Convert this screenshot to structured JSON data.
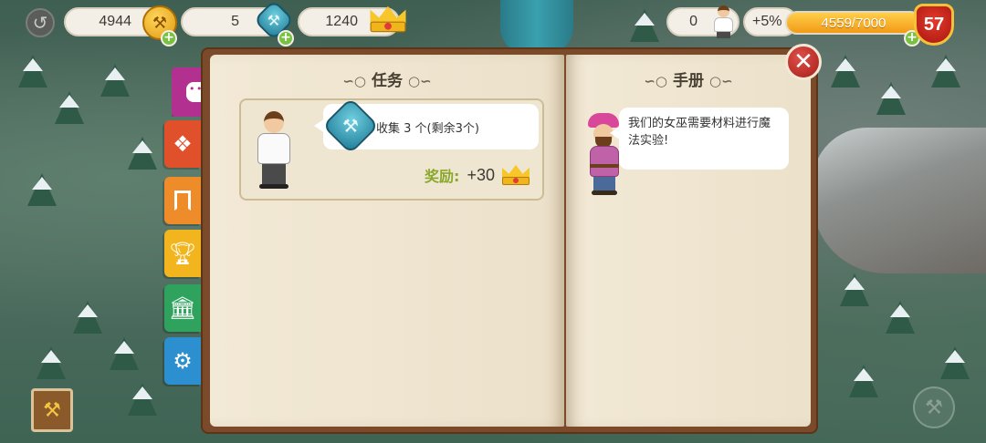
{
  "hud": {
    "hammers": "4944",
    "gems": "5",
    "crowns": "1240",
    "workers": "0",
    "bonus": "+5%",
    "xp": "4559/7000",
    "level": "57"
  },
  "book": {
    "left_title": "任务",
    "right_title": "手册",
    "task": {
      "text": "收集 3 个(剩余3个)",
      "reward_label": "奖励:",
      "reward_value": "+30"
    },
    "manual_text": "我们的女巫需要材料进行魔法实验!"
  },
  "tabs": [
    {
      "name": "chat",
      "color": "#b2308f"
    },
    {
      "name": "puzzle",
      "color": "#e0512b"
    },
    {
      "name": "bookmark",
      "color": "#ee8c2a"
    },
    {
      "name": "trophy",
      "color": "#f2b51e"
    },
    {
      "name": "museum",
      "color": "#2fa35e"
    },
    {
      "name": "settings",
      "color": "#2c8fd0"
    }
  ],
  "icons": {
    "back": "back-arrow-icon",
    "hammer": "hammer-icon",
    "gem": "gem-icon",
    "crown": "crown-icon",
    "worker": "worker-icon",
    "close": "close-icon"
  }
}
